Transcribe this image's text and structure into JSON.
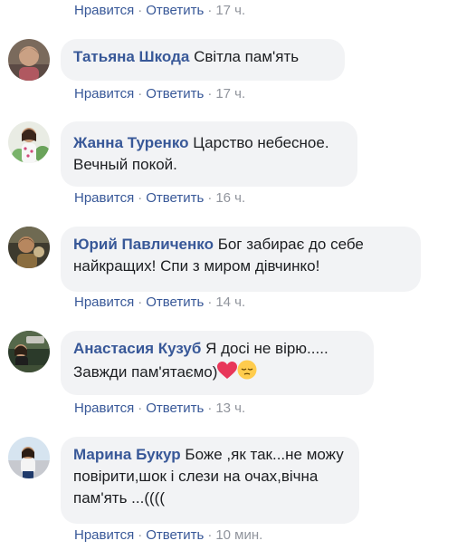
{
  "actions": {
    "like": "Нравится",
    "reply": "Ответить",
    "sep": "·"
  },
  "comments": [
    {
      "time": "17 ч."
    },
    {
      "author": "Татьяна Шкода",
      "text": "Світла пам'ять",
      "time": "17 ч.",
      "avatar_icon": "avatar-tatiana"
    },
    {
      "author": "Жанна Туренко",
      "text": "Царство небесное. Вечный покой.",
      "time": "16 ч.",
      "avatar_icon": "avatar-zhanna"
    },
    {
      "author": "Юрий Павличенко",
      "text": "Бог забирає до себе найкращих! Спи з миром дівчинко!",
      "time": "14 ч.",
      "avatar_icon": "avatar-yuriy"
    },
    {
      "author": "Анастасия Кузуб",
      "text": "Я досі не вірю..... Завжди пам'ятаємо)",
      "emojis": [
        "red-heart",
        "pensive-face"
      ],
      "time": "13 ч.",
      "avatar_icon": "avatar-anastasia"
    },
    {
      "author": "Марина Букур",
      "text": "Боже ,як так...не можу повірити,шок і слези на очах,вічна пам'ять ...((((",
      "time": "10 мин.",
      "avatar_icon": "avatar-marina"
    }
  ],
  "colors": {
    "link": "#385898",
    "bubble": "#f2f3f5",
    "meta": "#90949c"
  }
}
